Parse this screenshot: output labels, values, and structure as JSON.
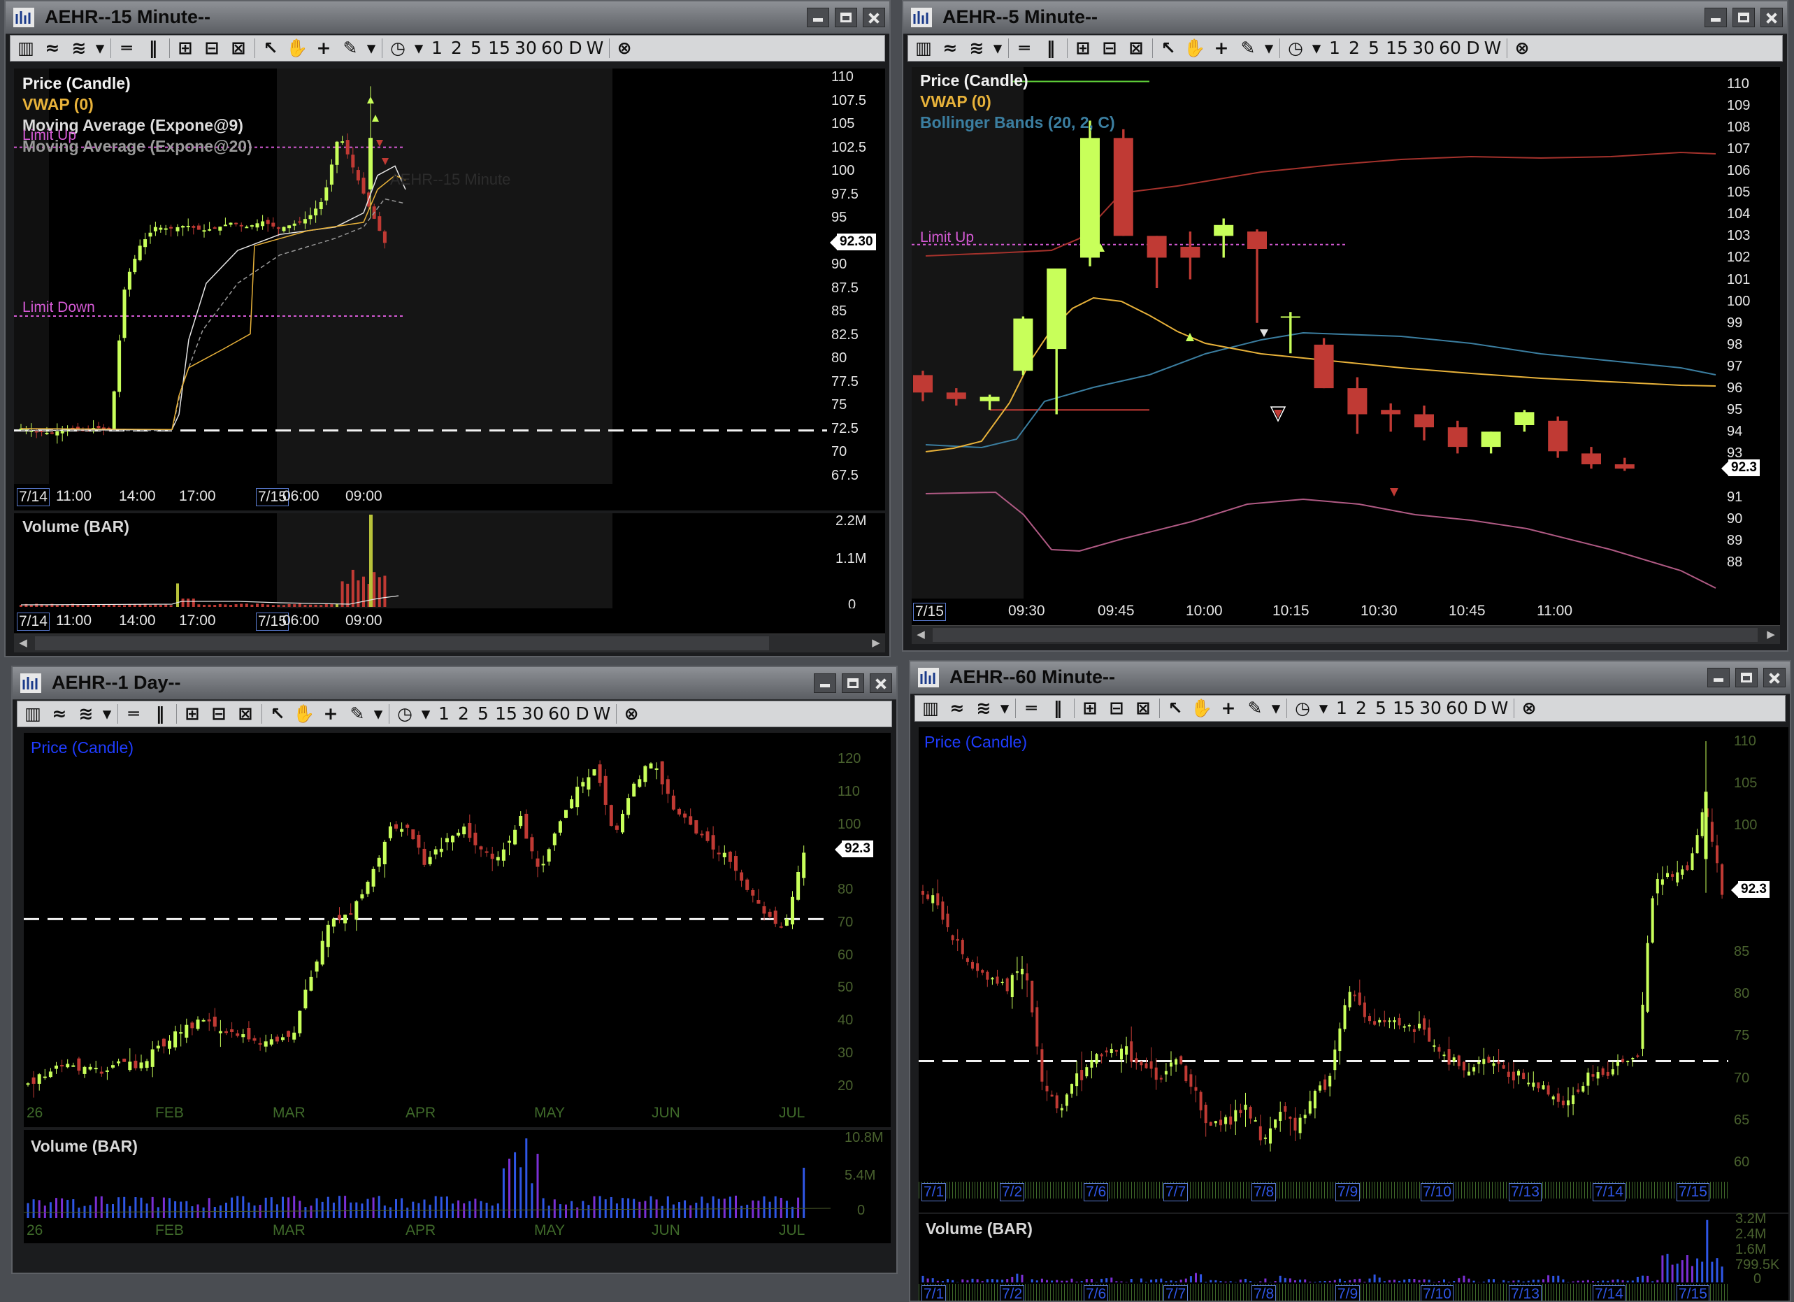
{
  "toolbar": {
    "periods": [
      "1",
      "2",
      "5",
      "15",
      "30",
      "60",
      "D",
      "W"
    ]
  },
  "colors": {
    "bull": "#c8ff5a",
    "bear": "#c03a34",
    "vwap": "#e8b23a",
    "limit": "#d55ad5",
    "boll_mid": "#3b7ea0"
  },
  "win15": {
    "title": "AEHR--15 Minute--",
    "legend": [
      "Price (Candle)",
      "VWAP (0)",
      "Moving Average (Expone@9)",
      "Moving Average (Expone@20)"
    ],
    "watermark": "AEHR--15 Minute",
    "limit_up": "Limit Up",
    "limit_down": "Limit Down",
    "y_ticks": [
      "110",
      "107.5",
      "105",
      "102.5",
      "100",
      "97.5",
      "95",
      "92.30",
      "90",
      "87.5",
      "85",
      "82.5",
      "80",
      "77.5",
      "75",
      "72.5",
      "70",
      "67.5"
    ],
    "last_price": "92.30",
    "x_labels": [
      "7/14",
      "11:00",
      "14:00",
      "17:00",
      "7/15",
      "06:00",
      "09:00"
    ],
    "volume_title": "Volume (BAR)",
    "vol_ticks": [
      "2.2M",
      "1.1M",
      "0"
    ]
  },
  "win5": {
    "title": "AEHR--5 Minute--",
    "legend": [
      "Price (Candle)",
      "VWAP (0)",
      "Bollinger Bands (20, 2, C)"
    ],
    "limit_up": "Limit Up",
    "y_ticks": [
      "110",
      "109",
      "108",
      "107",
      "106",
      "105",
      "104",
      "103",
      "102",
      "101",
      "100",
      "99",
      "98",
      "97",
      "96",
      "95",
      "94",
      "93",
      "92.3",
      "91",
      "90",
      "89",
      "88"
    ],
    "last_price": "92.3",
    "x_labels": [
      "7/15",
      "09:30",
      "09:45",
      "10:00",
      "10:15",
      "10:30",
      "10:45",
      "11:00"
    ]
  },
  "win1d": {
    "title": "AEHR--1 Day--",
    "legend": [
      "Price (Candle)"
    ],
    "y_ticks": [
      "120",
      "110",
      "100",
      "92.3",
      "80",
      "70",
      "60",
      "50",
      "40",
      "30",
      "20"
    ],
    "last_price": "92.3",
    "x_labels": [
      "26",
      "FEB",
      "MAR",
      "APR",
      "MAY",
      "JUN",
      "JUL"
    ],
    "volume_title": "Volume (BAR)",
    "vol_ticks": [
      "10.8M",
      "5.4M",
      "0"
    ]
  },
  "win60": {
    "title": "AEHR--60 Minute--",
    "legend": [
      "Price (Candle)"
    ],
    "y_ticks": [
      "110",
      "105",
      "100",
      "92.3",
      "85",
      "80",
      "75",
      "70",
      "65",
      "60"
    ],
    "last_price": "92.3",
    "x_labels": [
      "7/1",
      "7/2",
      "7/6",
      "7/7",
      "7/8",
      "7/9",
      "7/10",
      "7/13",
      "7/14",
      "7/15"
    ],
    "volume_title": "Volume (BAR)",
    "vol_ticks": [
      "3.2M",
      "2.4M",
      "1.6M",
      "799.5K",
      "0"
    ]
  },
  "chart_data": [
    {
      "type": "candlestick",
      "title": "AEHR--15 Minute--",
      "x": [
        "7/14 09:30",
        "7/14 11:00",
        "7/14 14:00",
        "7/14 16:00",
        "7/14 17:00",
        "7/14 18:00",
        "7/14 20:00",
        "7/15 04:00",
        "7/15 06:00",
        "7/15 08:00",
        "7/15 09:00",
        "7/15 09:30",
        "7/15 10:00",
        "7/15 10:30",
        "7/15 11:00"
      ],
      "close": [
        72.5,
        72.0,
        72.3,
        72.6,
        90.0,
        95.0,
        93.5,
        94.0,
        93.8,
        93.5,
        95.0,
        103.0,
        101.0,
        96.0,
        92.3
      ],
      "ylim": [
        67.5,
        110
      ],
      "limit_up": 102.5,
      "limit_down": 84.5
    },
    {
      "type": "candlestick",
      "title": "AEHR--5 Minute--",
      "x": [
        "09:20",
        "09:25",
        "09:30",
        "09:35",
        "09:40",
        "09:45",
        "09:50",
        "09:55",
        "10:00",
        "10:05",
        "10:10",
        "10:15",
        "10:20",
        "10:25",
        "10:30",
        "10:35",
        "10:40",
        "10:45",
        "10:50",
        "10:55",
        "11:00",
        "11:05"
      ],
      "open": [
        96.6,
        95.8,
        95.4,
        96.8,
        97.8,
        102.0,
        107.5,
        103.0,
        102.5,
        103.0,
        103.2,
        99.3,
        98.0,
        96.0,
        95.0,
        94.8,
        94.2,
        93.3,
        94.3,
        94.5,
        93.0,
        92.5
      ],
      "high": [
        96.8,
        96.0,
        95.7,
        99.3,
        101.5,
        108.3,
        107.9,
        103.0,
        103.2,
        103.8,
        103.3,
        99.5,
        98.3,
        96.5,
        95.3,
        95.2,
        94.5,
        94.0,
        95.0,
        94.7,
        93.3,
        92.8
      ],
      "low": [
        95.4,
        95.2,
        95.0,
        96.6,
        94.8,
        101.6,
        103.0,
        100.6,
        101.0,
        102.0,
        99.0,
        97.6,
        96.0,
        93.9,
        94.0,
        93.6,
        93.0,
        93.0,
        94.0,
        92.8,
        92.3,
        92.2
      ],
      "close": [
        95.8,
        95.5,
        95.6,
        99.2,
        101.5,
        107.5,
        103.0,
        102.0,
        102.0,
        103.5,
        102.4,
        99.3,
        96.0,
        94.8,
        94.8,
        94.2,
        93.3,
        94.0,
        94.9,
        93.1,
        92.5,
        92.3
      ],
      "ylim": [
        88,
        110.5
      ],
      "limit_up": 102.6
    },
    {
      "type": "candlestick",
      "title": "AEHR--1 Day--",
      "x": [
        "26",
        "FEB",
        "MAR",
        "APR",
        "MAY",
        "JUN",
        "JUL"
      ],
      "close": [
        22,
        27,
        38,
        70,
        95,
        110,
        92.3
      ],
      "ylim": [
        18,
        125
      ]
    },
    {
      "type": "candlestick",
      "title": "AEHR--60 Minute--",
      "x": [
        "7/1",
        "7/2",
        "7/6",
        "7/7",
        "7/8",
        "7/9",
        "7/10",
        "7/13",
        "7/14",
        "7/15"
      ],
      "close": [
        89,
        69,
        71,
        65,
        66,
        76,
        74,
        69,
        72,
        92.3
      ],
      "ylim": [
        59,
        111
      ]
    }
  ]
}
